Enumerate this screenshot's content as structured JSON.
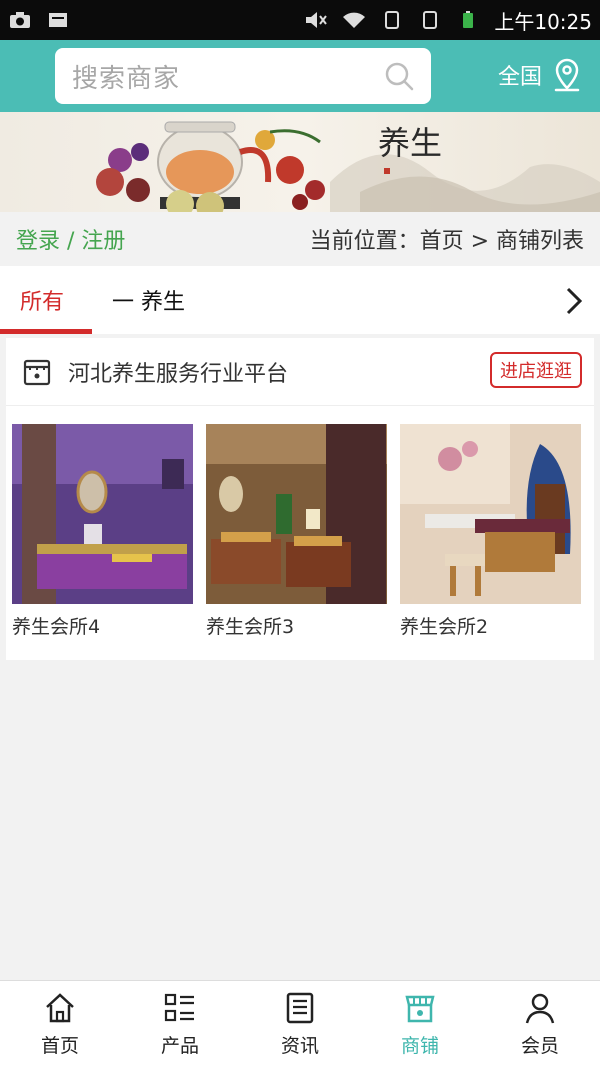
{
  "status_bar": {
    "time": "上午10:25"
  },
  "header": {
    "search_placeholder": "搜索商家",
    "region": "全国",
    "theme_color": "#4bbdb5"
  },
  "banner": {
    "calligraphy": "养生"
  },
  "breadcrumb": {
    "login": "登录 / 注册",
    "location": "当前位置：首页 > 商铺列表"
  },
  "tabs": {
    "active": "所有",
    "second": "一 养生"
  },
  "store": {
    "name": "河北养生服务行业平台",
    "visit_label": "进店逛逛",
    "items": [
      {
        "caption": "养生会所4"
      },
      {
        "caption": "养生会所3"
      },
      {
        "caption": "养生会所2"
      }
    ]
  },
  "bottom_nav": [
    {
      "label": "首页",
      "icon": "home-icon"
    },
    {
      "label": "产品",
      "icon": "list-icon"
    },
    {
      "label": "资讯",
      "icon": "news-icon"
    },
    {
      "label": "商铺",
      "icon": "store-icon",
      "active": true
    },
    {
      "label": "会员",
      "icon": "user-icon"
    }
  ],
  "colors": {
    "accent": "#d32b2b",
    "green": "#45a54f",
    "teal": "#3fb6ad"
  }
}
